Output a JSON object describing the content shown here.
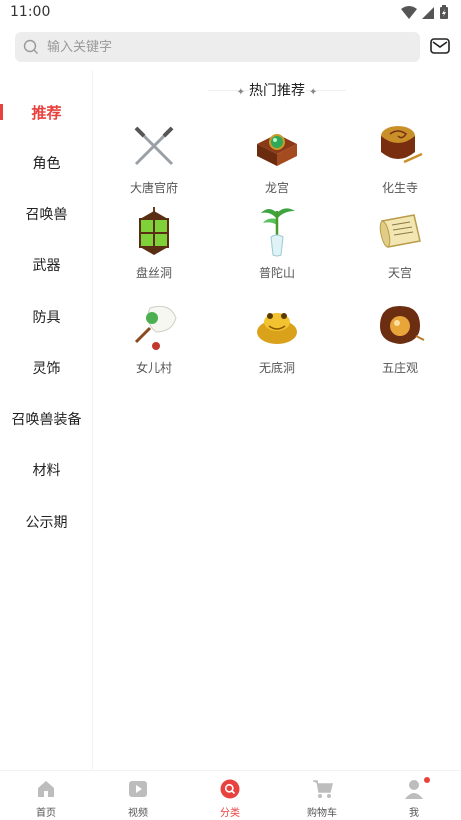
{
  "status_bar": {
    "time": "11:00"
  },
  "search": {
    "placeholder": "输入关键字"
  },
  "sidebar": {
    "items": [
      {
        "label": "推荐",
        "active": true
      },
      {
        "label": "角色"
      },
      {
        "label": "召唤兽"
      },
      {
        "label": "武器"
      },
      {
        "label": "防具"
      },
      {
        "label": "灵饰"
      },
      {
        "label": "召唤兽装备"
      },
      {
        "label": "材料"
      },
      {
        "label": "公示期"
      }
    ]
  },
  "main": {
    "section_title": "热门推荐",
    "items": [
      {
        "label": "大唐官府",
        "icon": "crossed-swords-icon"
      },
      {
        "label": "龙宫",
        "icon": "treasure-box-icon"
      },
      {
        "label": "化生寺",
        "icon": "drum-icon"
      },
      {
        "label": "盘丝洞",
        "icon": "lantern-icon"
      },
      {
        "label": "普陀山",
        "icon": "bamboo-vase-icon"
      },
      {
        "label": "天宫",
        "icon": "scroll-icon"
      },
      {
        "label": "女儿村",
        "icon": "feather-fan-icon"
      },
      {
        "label": "无底洞",
        "icon": "golden-toad-icon"
      },
      {
        "label": "五庄观",
        "icon": "ginseng-fruit-box-icon"
      }
    ]
  },
  "bottom_nav": {
    "items": [
      {
        "label": "首页",
        "icon": "home-icon"
      },
      {
        "label": "视频",
        "icon": "video-icon"
      },
      {
        "label": "分类",
        "icon": "category-icon",
        "active": true
      },
      {
        "label": "购物车",
        "icon": "cart-icon"
      },
      {
        "label": "我",
        "icon": "user-icon"
      }
    ]
  },
  "colors": {
    "accent": "#e8423f",
    "search_bg": "#ededed"
  }
}
